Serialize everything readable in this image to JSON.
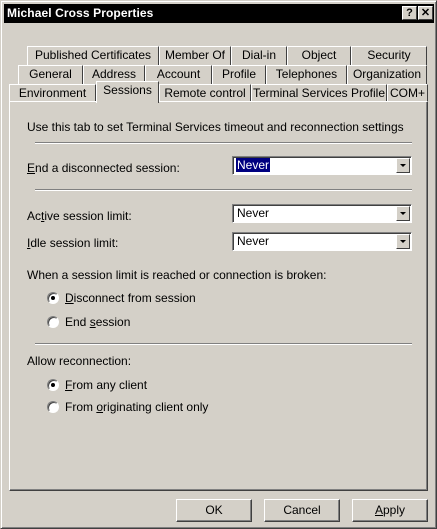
{
  "window": {
    "title": "Michael Cross Properties",
    "help_label": "?",
    "close_label": "✕"
  },
  "tabs": {
    "row1": [
      "Published Certificates",
      "Member Of",
      "Dial-in",
      "Object",
      "Security"
    ],
    "row2": [
      "General",
      "Address",
      "Account",
      "Profile",
      "Telephones",
      "Organization"
    ],
    "row3": [
      "Environment",
      "Sessions",
      "Remote control",
      "Terminal Services Profile",
      "COM+"
    ],
    "active": "Sessions"
  },
  "sessions": {
    "intro": "Use this tab to set Terminal Services timeout and reconnection settings",
    "end_disconnected": {
      "label_key": "E",
      "label_rest": "nd a disconnected session:",
      "value": "Never"
    },
    "active_limit": {
      "label_pre": "Ac",
      "label_key": "t",
      "label_rest": "ive session limit:",
      "value": "Never"
    },
    "idle_limit": {
      "label_pre": "",
      "label_key": "I",
      "label_rest": "dle session limit:",
      "value": "Never"
    },
    "limit_reached": {
      "label": "When a session limit is reached or connection is broken:",
      "options": [
        {
          "pre": "",
          "key": "D",
          "rest": "isconnect from session",
          "checked": true
        },
        {
          "pre": "End ",
          "key": "s",
          "rest": "ession",
          "checked": false
        }
      ]
    },
    "reconnection": {
      "label": "Allow reconnection:",
      "options": [
        {
          "pre": "",
          "key": "F",
          "rest": "rom any client",
          "checked": true
        },
        {
          "pre": "From ",
          "key": "o",
          "rest": "riginating client only",
          "checked": false
        }
      ]
    }
  },
  "buttons": {
    "ok": "OK",
    "cancel": "Cancel",
    "apply_key": "A",
    "apply_rest": "pply"
  }
}
